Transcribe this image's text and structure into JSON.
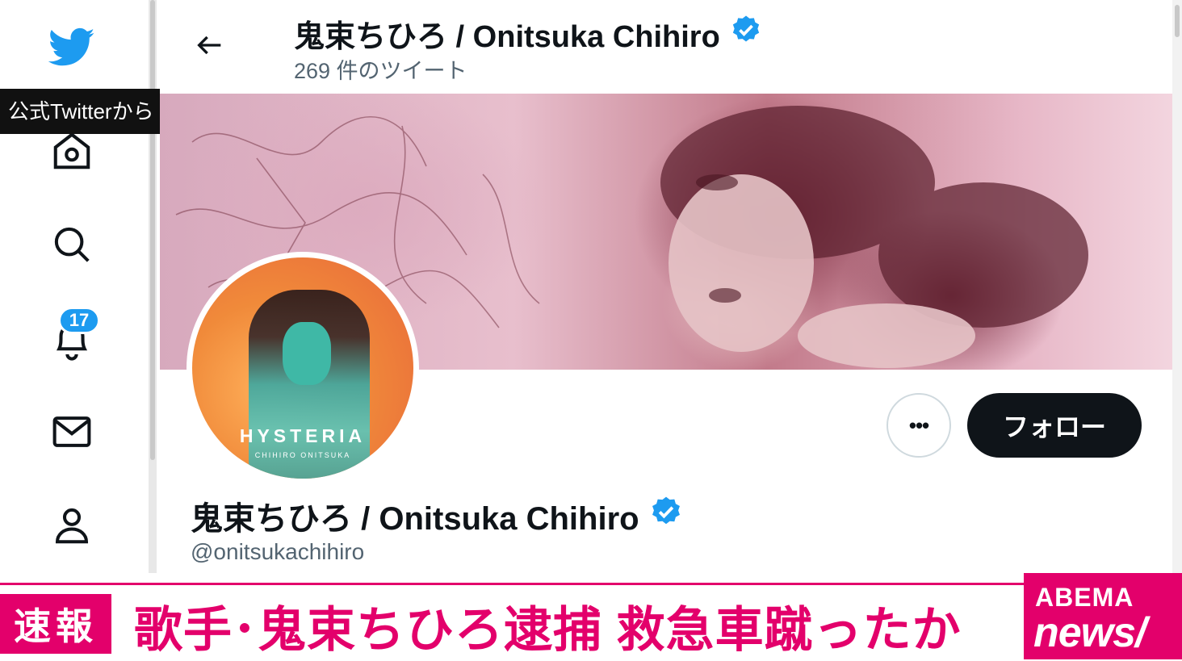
{
  "caption_tag": "公式Twitterから",
  "nav": {
    "notifications_badge": "17"
  },
  "header": {
    "name": "鬼束ちひろ / Onitsuka Chihiro",
    "tweet_count": "269 件のツイート"
  },
  "avatar": {
    "album_title": "HYSTERIA",
    "album_artist": "CHIHIRO ONITSUKA"
  },
  "actions": {
    "more_label": "•••",
    "follow_label": "フォロー"
  },
  "profile": {
    "name": "鬼束ちひろ / Onitsuka Chihiro",
    "handle": "@onitsukachihiro"
  },
  "news": {
    "tag": "速報",
    "headline": "歌手･鬼束ちひろ逮捕 救急車蹴ったか",
    "logo_line1": "ABEMA",
    "logo_line2": "news/"
  },
  "colors": {
    "twitter_blue": "#1d9bf0",
    "follow_bg": "#0f1419",
    "news_accent": "#e3006b"
  },
  "icons": [
    "twitter-logo-icon",
    "home-icon",
    "search-icon",
    "bell-icon",
    "mail-icon",
    "profile-icon",
    "back-arrow-icon",
    "verified-icon",
    "more-icon"
  ]
}
